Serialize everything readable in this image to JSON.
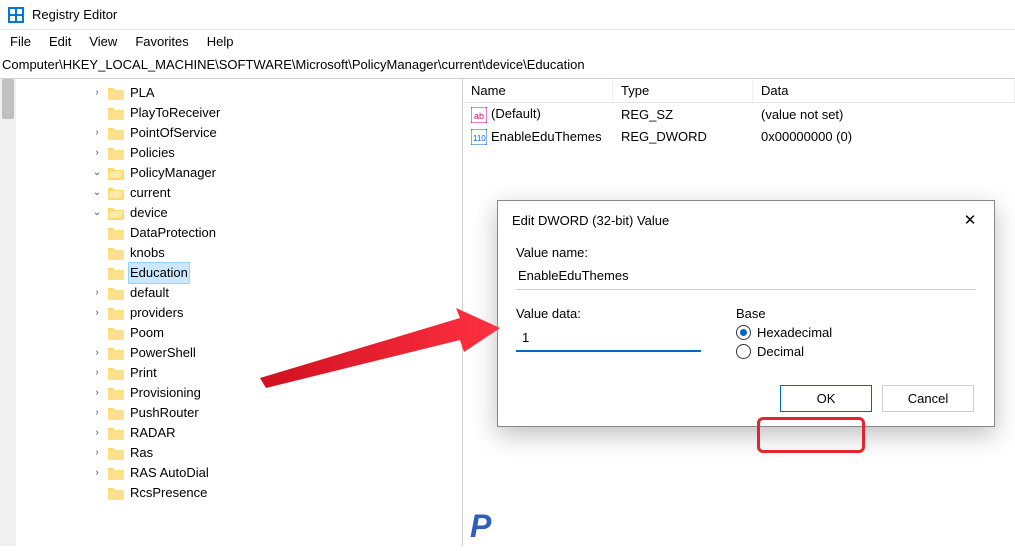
{
  "app": {
    "title": "Registry Editor",
    "menu": [
      "File",
      "Edit",
      "View",
      "Favorites",
      "Help"
    ],
    "address": "Computer\\HKEY_LOCAL_MACHINE\\SOFTWARE\\Microsoft\\PolicyManager\\current\\device\\Education"
  },
  "tree": {
    "items": [
      {
        "label": "PLA",
        "toggle": ">"
      },
      {
        "label": "PlayToReceiver",
        "toggle": ""
      },
      {
        "label": "PointOfService",
        "toggle": ">"
      },
      {
        "label": "Policies",
        "toggle": ">"
      },
      {
        "label": "PolicyManager",
        "toggle": "v",
        "open": true,
        "children": [
          {
            "label": "current",
            "toggle": "v",
            "open": true,
            "children": [
              {
                "label": "device",
                "toggle": "v",
                "open": true,
                "children": [
                  {
                    "label": "DataProtection",
                    "toggle": ""
                  },
                  {
                    "label": "knobs",
                    "toggle": ""
                  },
                  {
                    "label": "Education",
                    "toggle": "",
                    "selected": true
                  }
                ]
              }
            ]
          },
          {
            "label": "default",
            "toggle": ">"
          },
          {
            "label": "providers",
            "toggle": ">"
          }
        ]
      },
      {
        "label": "Poom",
        "toggle": ""
      },
      {
        "label": "PowerShell",
        "toggle": ">"
      },
      {
        "label": "Print",
        "toggle": ">"
      },
      {
        "label": "Provisioning",
        "toggle": ">"
      },
      {
        "label": "PushRouter",
        "toggle": ">"
      },
      {
        "label": "RADAR",
        "toggle": ">"
      },
      {
        "label": "Ras",
        "toggle": ">"
      },
      {
        "label": "RAS AutoDial",
        "toggle": ">"
      },
      {
        "label": "RcsPresence",
        "toggle": ""
      }
    ]
  },
  "list": {
    "headers": {
      "name": "Name",
      "type": "Type",
      "data": "Data"
    },
    "rows": [
      {
        "icon": "str",
        "name": "(Default)",
        "type": "REG_SZ",
        "data": "(value not set)"
      },
      {
        "icon": "bin",
        "name": "EnableEduThemes",
        "type": "REG_DWORD",
        "data": "0x00000000 (0)"
      }
    ]
  },
  "dialog": {
    "title": "Edit DWORD (32-bit) Value",
    "value_name_label": "Value name:",
    "value_name": "EnableEduThemes",
    "value_data_label": "Value data:",
    "value_data": "1",
    "base_label": "Base",
    "hex_label": "Hexadecimal",
    "dec_label": "Decimal",
    "ok_label": "OK",
    "cancel_label": "Cancel"
  },
  "watermark": "P"
}
